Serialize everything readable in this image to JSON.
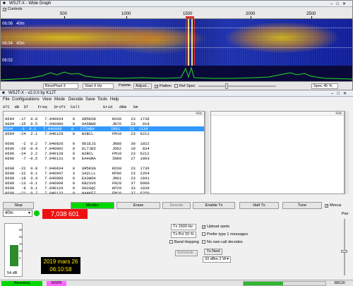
{
  "wide_graph": {
    "title": "WSJT-X - Wide Graph",
    "controls_label": "Controls",
    "ruler_ticks": [
      "500",
      "1000",
      "1500",
      "2000",
      "2500"
    ],
    "band_labels": [
      "06:06",
      "40m",
      "06:04",
      "40m",
      "06:02"
    ],
    "bins_label": "Bins/Pixel 3",
    "start_label": "Start 0 Hz",
    "palette_label": "Palette",
    "adjust_label": "Adjust...",
    "flatten_label": "Flatten",
    "ref_spec_label": "Ref Spec",
    "spec_label": "Spec 45 %"
  },
  "main_window": {
    "title": "WSJT-X - v2.0.0 by K1JT",
    "menu": [
      "File",
      "Configurations",
      "View",
      "Mode",
      "Decode",
      "Save",
      "Tools",
      "Help"
    ],
    "header": "UTC  dB  DT    Freq   Drift  Call          Grid   dBm   km",
    "band_marker": "40m",
    "left_rows": [
      {
        "text": "0604  -17  0.0   7.040034    0   UR5KSN       KO30    23  1736",
        "sel": false
      },
      {
        "text": "0604  -25  0.5   7.040080    0   9A5BWO       JN76    23   919",
        "sel": false
      },
      {
        "text": "0604   -3  0.1   7.040098    0   CT2HBH       IN61    23  1130",
        "sel": true
      },
      {
        "text": "0604  -24  2.1   7.040129    0   W2BCL        FM19    23  6212",
        "sel": false
      },
      {
        "text": "",
        "sel": false
      },
      {
        "text": "0606   -2  0.2   7.040026    0   OE1EJS       JN88    30  1022",
        "sel": false
      },
      {
        "text": "0606  -26 -0.4   7.040092    0   DL7JED       JO62    10   834",
        "sel": false
      },
      {
        "text": "0606  -24  2.2   7.040128    0   W2BCL        FM19    23  6212",
        "sel": false
      },
      {
        "text": "0606   -7 -0.5   7.040131    0   EA4URA       IN80    27  1003",
        "sel": false
      },
      {
        "text": "",
        "sel": false
      },
      {
        "text": "0608  -22  0.0   7.040034    0   UR5KSN       KO30    23  1736",
        "sel": false
      },
      {
        "text": "0608  -22  0.1   7.040047    3   SA2LLL       KP06    23  2264",
        "sel": false
      },
      {
        "text": "0608  -18  0.4   7.040096    0   EA3WOA       JN01    23  1041",
        "sel": false
      },
      {
        "text": "0608  -13 -0.1   7.040098    0   KB2SVO       FN20    37  6009",
        "sel": false
      },
      {
        "text": "0608   -9  0.1   7.040120    0   OH2GQC       KP20    33  1939",
        "sel": false
      },
      {
        "text": "0608  -21  0.7   7.040133    0   WA4KFZ       FM18    37  6250",
        "sel": false
      }
    ],
    "buttons": {
      "stop": "Stop",
      "monitor": "Monitor",
      "erase": "Erase",
      "decode": "Decode",
      "enable_tx": "Enable Tx",
      "halt_tx": "Halt Tx",
      "tune": "Tune",
      "menus": "Menus"
    },
    "band": "40m",
    "frequency": "7,038 601",
    "meter_db": "54 dB",
    "meter_scale": [
      "80",
      "60",
      "40",
      "20",
      "0"
    ],
    "meter_level_percent": 54,
    "date": "2019 mars 26",
    "time": "06:10:58",
    "tx_freq": "Tx 1500 Hz",
    "tx_pct": "Tx Pct 15 %",
    "band_hopping": "Band Hopping",
    "schedule": "Schedule ...",
    "upload_spots": "Upload spots",
    "prefer_type1": "Prefer type 1 messages",
    "no_own_call": "No own call decodes",
    "tx_next": "Tx Next",
    "power": "33 dBm  2 W",
    "pwr_label": "Pwr",
    "status": {
      "receiving": "Receiving",
      "mode": "WSPR",
      "count": "58/120"
    }
  }
}
